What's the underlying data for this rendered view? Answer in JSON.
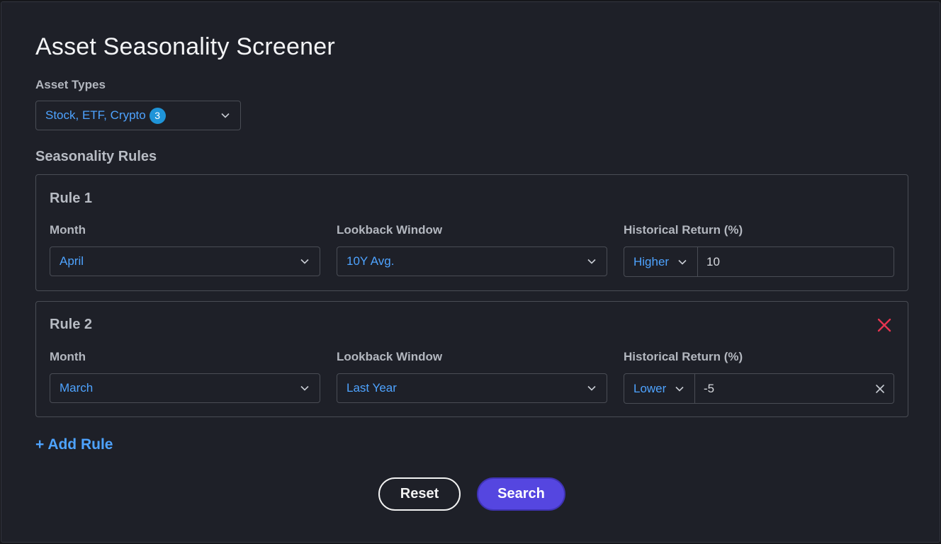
{
  "page": {
    "title": "Asset Seasonality Screener"
  },
  "asset_types": {
    "label": "Asset Types",
    "value": "Stock, ETF, Crypto",
    "count": "3"
  },
  "seasonality": {
    "section_title": "Seasonality Rules",
    "rules": [
      {
        "title": "Rule 1",
        "month_label": "Month",
        "month_value": "April",
        "lookback_label": "Lookback Window",
        "lookback_value": "10Y Avg.",
        "return_label": "Historical Return (%)",
        "return_direction": "Higher",
        "return_value": "10"
      },
      {
        "title": "Rule 2",
        "month_label": "Month",
        "month_value": "March",
        "lookback_label": "Lookback Window",
        "lookback_value": "Last Year",
        "return_label": "Historical Return (%)",
        "return_direction": "Lower",
        "return_value": "-5"
      }
    ],
    "add_rule_label": "+ Add Rule"
  },
  "actions": {
    "reset_label": "Reset",
    "search_label": "Search"
  },
  "colors": {
    "accent_blue": "#4ea3ff",
    "search_button": "#5546e0",
    "remove_red": "#e5344f",
    "badge": "#1f94d8"
  },
  "icons": {
    "chevron": "chevron-down-icon",
    "remove": "close-icon",
    "clear": "clear-icon"
  }
}
